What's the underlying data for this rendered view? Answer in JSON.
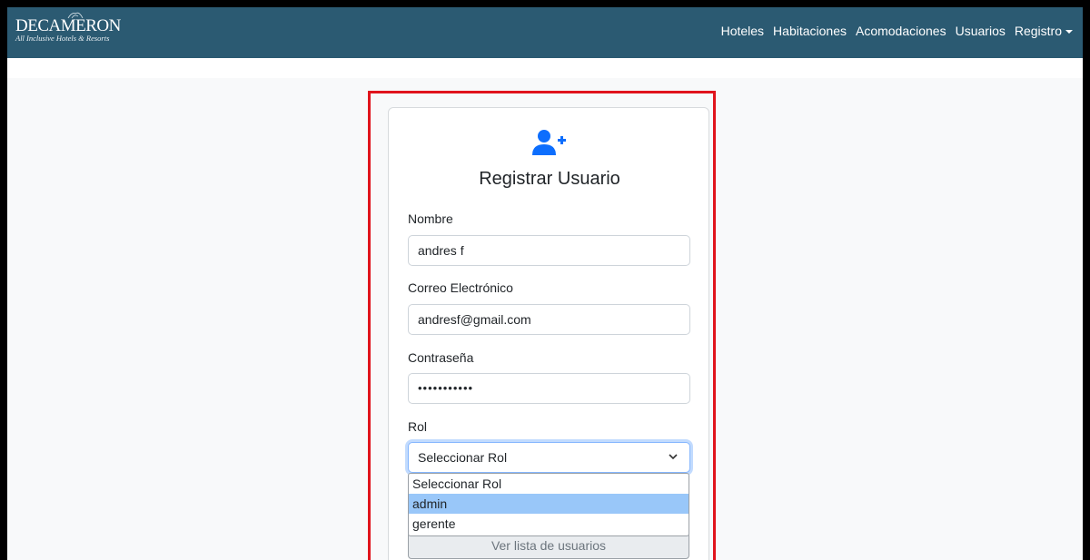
{
  "brand": {
    "name": "DECAMERON",
    "tagline": "All Inclusive Hotels & Resorts"
  },
  "nav": {
    "items": [
      {
        "label": "Hoteles"
      },
      {
        "label": "Habitaciones"
      },
      {
        "label": "Acomodaciones"
      },
      {
        "label": "Usuarios"
      },
      {
        "label": "Registro"
      }
    ]
  },
  "form": {
    "title": "Registrar Usuario",
    "icon": "user-plus-icon",
    "nombre_label": "Nombre",
    "nombre_value": "andres f",
    "correo_label": "Correo Electrónico",
    "correo_value": "andresf@gmail.com",
    "password_label": "Contraseña",
    "password_value": "•••••••••••",
    "rol_label": "Rol",
    "rol_value": "Seleccionar Rol",
    "rol_options": [
      {
        "label": "Seleccionar Rol"
      },
      {
        "label": "admin"
      },
      {
        "label": "gerente"
      }
    ],
    "list_button": "Ver lista de usuarios"
  },
  "colors": {
    "navbar": "#2b5a72",
    "accent": "#0d6efd",
    "highlight": "#e0141c",
    "option_hover": "#99c7f9"
  }
}
